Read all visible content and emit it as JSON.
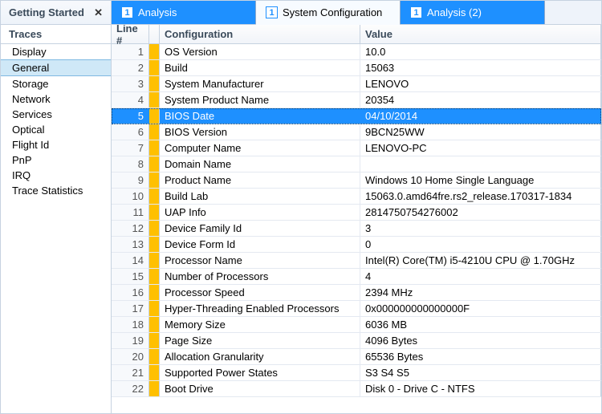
{
  "sideHeader": "Getting Started",
  "sideTitle": "Traces",
  "sideItems": [
    "Display",
    "General",
    "Storage",
    "Network",
    "Services",
    "Optical",
    "Flight Id",
    "PnP",
    "IRQ",
    "Trace Statistics"
  ],
  "sideSelectedIndex": 1,
  "tabs": [
    {
      "label": "Analysis"
    },
    {
      "label": "System Configuration"
    },
    {
      "label": "Analysis (2)"
    }
  ],
  "tabActiveIndex": 1,
  "headers": {
    "line": "Line #",
    "conf": "Configuration",
    "val": "Value"
  },
  "selectedRowIndex": 4,
  "rows": [
    {
      "line": 1,
      "conf": "OS Version",
      "val": "10.0"
    },
    {
      "line": 2,
      "conf": "Build",
      "val": "15063"
    },
    {
      "line": 3,
      "conf": "System Manufacturer",
      "val": "LENOVO"
    },
    {
      "line": 4,
      "conf": "System Product Name",
      "val": "20354"
    },
    {
      "line": 5,
      "conf": "BIOS Date",
      "val": "04/10/2014"
    },
    {
      "line": 6,
      "conf": "BIOS Version",
      "val": "9BCN25WW"
    },
    {
      "line": 7,
      "conf": "Computer Name",
      "val": "LENOVO-PC"
    },
    {
      "line": 8,
      "conf": "Domain Name",
      "val": ""
    },
    {
      "line": 9,
      "conf": "Product Name",
      "val": "Windows 10 Home Single Language"
    },
    {
      "line": 10,
      "conf": "Build Lab",
      "val": "15063.0.amd64fre.rs2_release.170317-1834"
    },
    {
      "line": 11,
      "conf": "UAP Info",
      "val": "2814750754276002"
    },
    {
      "line": 12,
      "conf": "Device Family Id",
      "val": "3"
    },
    {
      "line": 13,
      "conf": "Device Form Id",
      "val": "0"
    },
    {
      "line": 14,
      "conf": "Processor Name",
      "val": "Intel(R) Core(TM) i5-4210U CPU @ 1.70GHz"
    },
    {
      "line": 15,
      "conf": "Number of Processors",
      "val": "4"
    },
    {
      "line": 16,
      "conf": "Processor Speed",
      "val": "2394 MHz"
    },
    {
      "line": 17,
      "conf": "Hyper-Threading Enabled Processors",
      "val": "0x000000000000000F"
    },
    {
      "line": 18,
      "conf": "Memory Size",
      "val": "6036 MB"
    },
    {
      "line": 19,
      "conf": "Page Size",
      "val": "4096 Bytes"
    },
    {
      "line": 20,
      "conf": "Allocation Granularity",
      "val": "65536 Bytes"
    },
    {
      "line": 21,
      "conf": "Supported Power States",
      "val": "S3 S4 S5"
    },
    {
      "line": 22,
      "conf": "Boot Drive",
      "val": "Disk 0 - Drive C - NTFS"
    }
  ]
}
